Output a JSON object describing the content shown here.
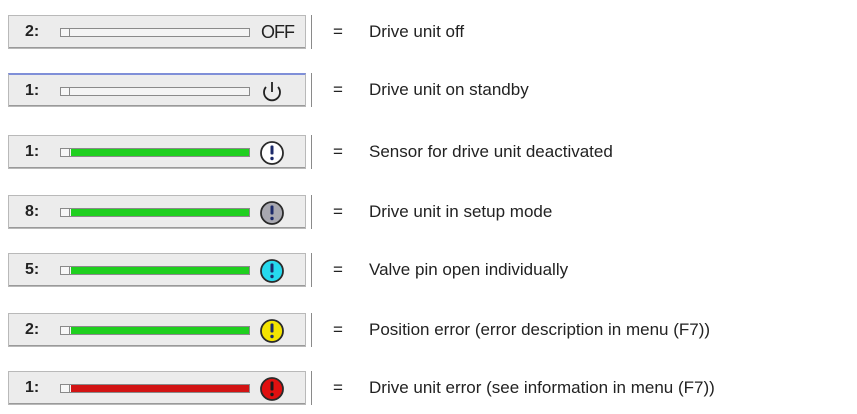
{
  "rows": [
    {
      "number": "2:",
      "status_text": "OFF",
      "icon": "off-text",
      "fill_color": null,
      "equals": "=",
      "description": "Drive unit off"
    },
    {
      "number": "1:",
      "icon": "power-standby-icon",
      "fill_color": null,
      "equals": "=",
      "description": "Drive unit on standby"
    },
    {
      "number": "1:",
      "icon": "exclamation-circle-icon",
      "icon_fill": "#ffffff",
      "fill_color": "#1fcf1f",
      "equals": "=",
      "description": "Sensor for drive unit deactivated"
    },
    {
      "number": "8:",
      "icon": "exclamation-circle-icon",
      "icon_fill": "#a8a8b0",
      "fill_color": "#1fcf1f",
      "equals": "=",
      "description": "Drive unit in setup mode"
    },
    {
      "number": "5:",
      "icon": "exclamation-circle-icon",
      "icon_fill": "#26d9ee",
      "fill_color": "#1fcf1f",
      "equals": "=",
      "description": "Valve pin open individually"
    },
    {
      "number": "2:",
      "icon": "exclamation-circle-icon",
      "icon_fill": "#f4e400",
      "fill_color": "#1fcf1f",
      "equals": "=",
      "description": "Position error (error description in menu (F7))"
    },
    {
      "number": "1:",
      "icon": "exclamation-circle-icon",
      "icon_fill": "#e01010",
      "fill_color": "#d21414",
      "equals": "=",
      "description": "Drive unit error (see information in menu (F7))"
    }
  ]
}
